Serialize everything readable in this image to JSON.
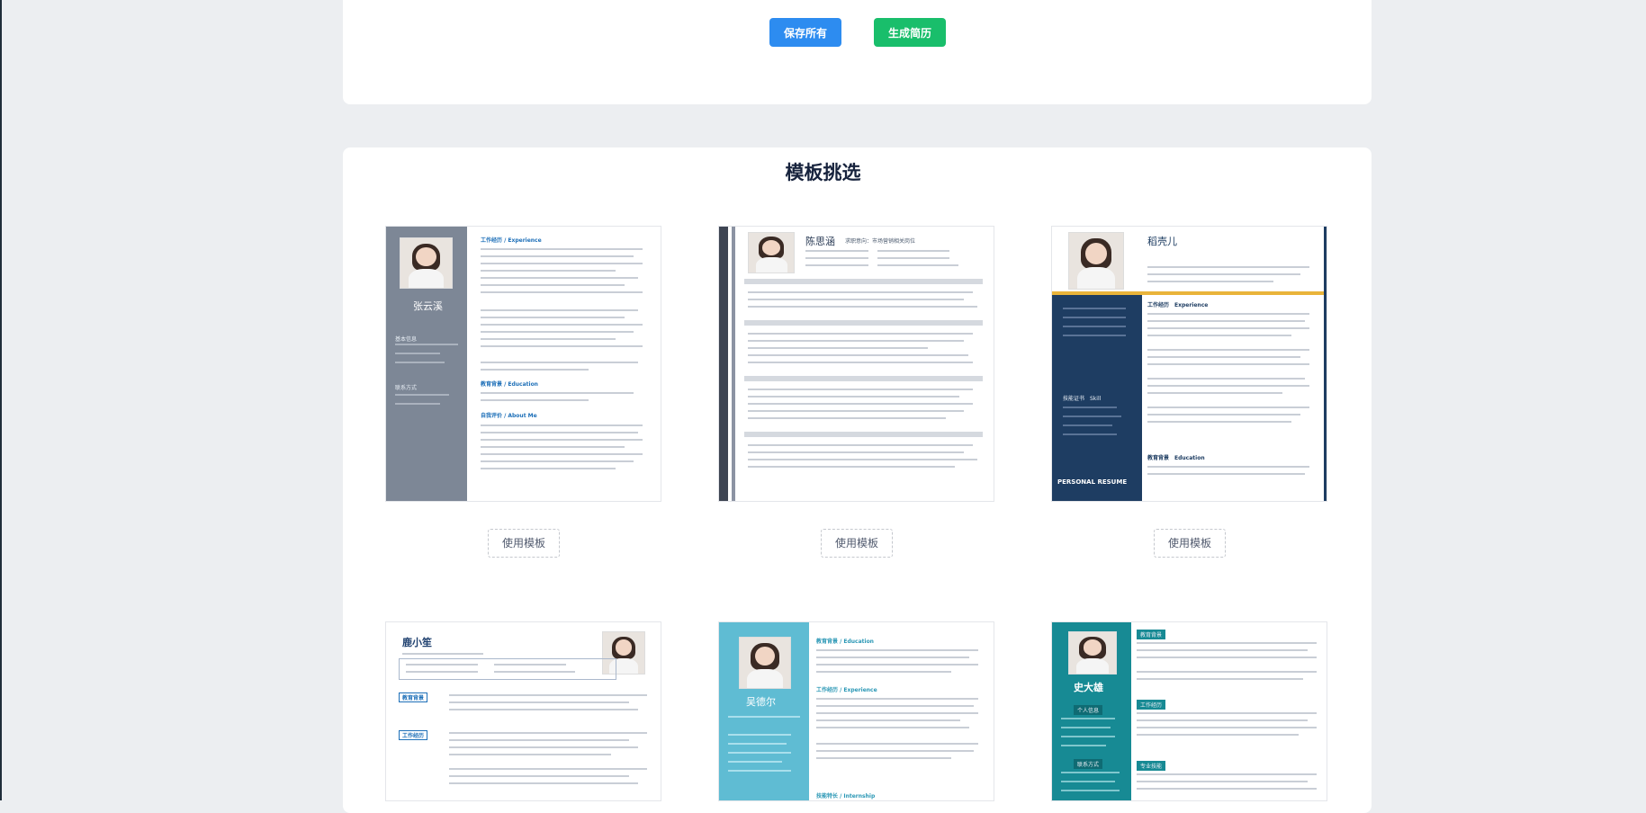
{
  "toolbar": {
    "save_label": "保存所有",
    "generate_label": "生成简历"
  },
  "templates_section": {
    "title": "模板挑选",
    "use_label": "使用模板",
    "templates": [
      {
        "name": "张云溪",
        "h1": "工作经历 / Experience",
        "h2": "教育背景 / Education",
        "h3": "自我评价 / About Me",
        "sidebar_h1": "基本信息",
        "sidebar_h2": "联系方式"
      },
      {
        "name": "陈思涵",
        "subtitle": "求职意向：市场营销相关岗位"
      },
      {
        "name": "稻壳儿",
        "h1": "工作经历　Experience",
        "h2": "教育背景　Education",
        "skill": "技能证书　Skill",
        "footer": "PERSONAL RESUME"
      },
      {
        "name": "鹿小笙",
        "h1": "教育背景",
        "h2": "工作经历"
      },
      {
        "name": "吴德尔",
        "h1": "教育背景 / Education",
        "h2": "工作经历 / Experience",
        "h3": "技能特长 / Internship"
      },
      {
        "name": "史大雄",
        "h1": "教育背景",
        "h2": "工作经历",
        "h3": "专业技能",
        "side_h": "个人信息",
        "side_h2": "联系方式"
      }
    ]
  },
  "colors": {
    "save": "#2d8cf0",
    "generate": "#19be6b",
    "title": "#17233d",
    "page_bg": "#eceef1"
  }
}
